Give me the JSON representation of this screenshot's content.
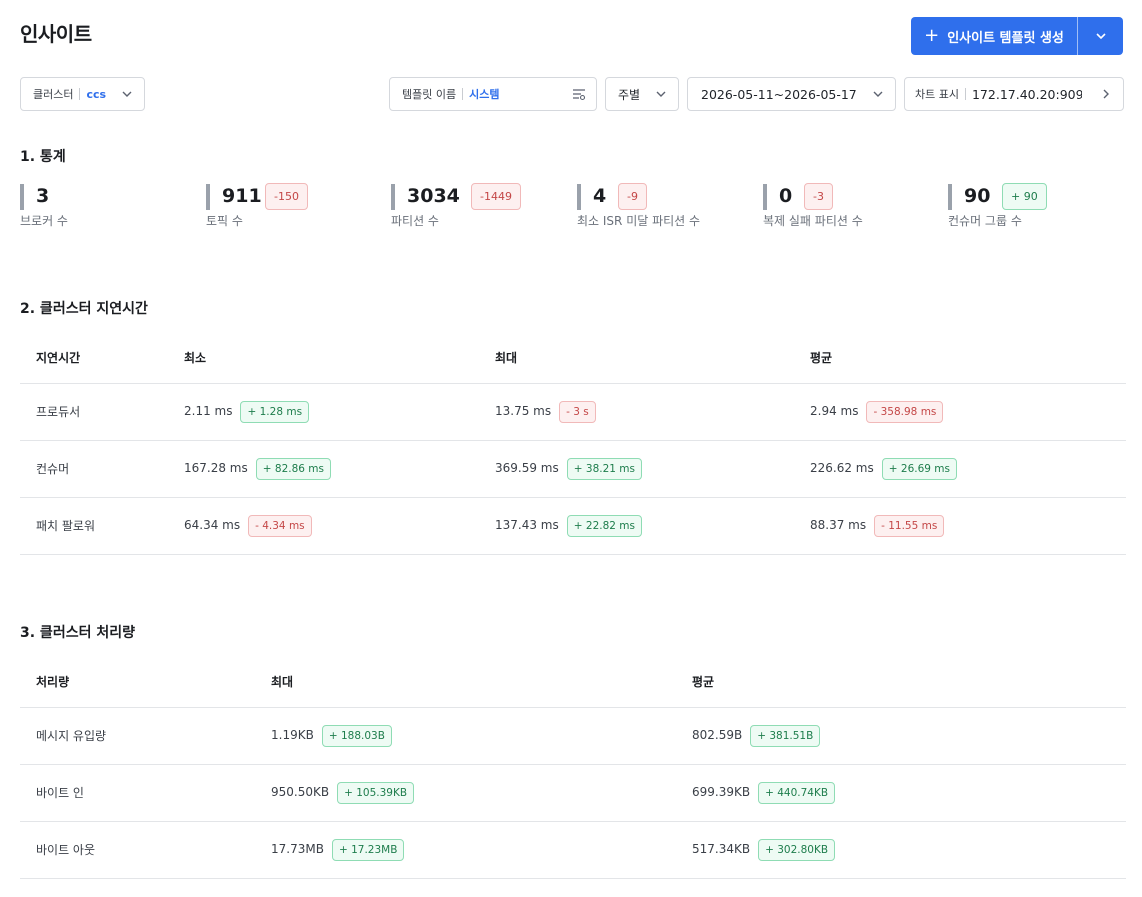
{
  "header": {
    "title": "인사이트",
    "create_button": "인사이트 템플릿 생성",
    "create_plus": "+"
  },
  "filters": {
    "cluster_label": "클러스터",
    "cluster_value": "ccs",
    "template_label": "템플릿 이름",
    "template_value": "시스템",
    "period_value": "주별",
    "date_range": "2026-05-11~2026-05-17",
    "chart_label": "차트 표시",
    "chart_value": "172.17.40.20:9092"
  },
  "stats": {
    "title": "1. 통계",
    "items": [
      {
        "value": "3",
        "caption": "브로커 수"
      },
      {
        "value": "911",
        "delta": "-150",
        "caption": "토픽 수"
      },
      {
        "value": "3034",
        "delta": "-1449",
        "caption": "파티션 수"
      },
      {
        "value": "4",
        "delta": "-9",
        "caption": "최소 ISR 미달 파티션 수"
      },
      {
        "value": "0",
        "delta": "-3",
        "caption": "복제 실패 파티션 수"
      },
      {
        "value": "90",
        "delta": "+ 90",
        "caption": "컨슈머 그룹 수"
      }
    ]
  },
  "latency": {
    "title": "2. 클러스터 지연시간",
    "columns": [
      "지연시간",
      "최소",
      "최대",
      "평균"
    ],
    "rows": [
      {
        "name": "프로듀서",
        "min": "2.11 ms",
        "min_delta": "+ 1.28 ms",
        "max": "13.75 ms",
        "max_delta": "- 3 s",
        "avg": "2.94 ms",
        "avg_delta": "- 358.98 ms"
      },
      {
        "name": "컨슈머",
        "min": "167.28 ms",
        "min_delta": "+ 82.86 ms",
        "max": "369.59 ms",
        "max_delta": "+ 38.21 ms",
        "avg": "226.62 ms",
        "avg_delta": "+ 26.69 ms"
      },
      {
        "name": "패치 팔로워",
        "min": "64.34 ms",
        "min_delta": "- 4.34 ms",
        "max": "137.43 ms",
        "max_delta": "+ 22.82 ms",
        "avg": "88.37 ms",
        "avg_delta": "- 11.55 ms"
      }
    ]
  },
  "throughput": {
    "title": "3. 클러스터 처리량",
    "columns": [
      "처리량",
      "최대",
      "평균"
    ],
    "rows": [
      {
        "name": "메시지 유입량",
        "max": "1.19KB",
        "max_delta": "+ 188.03B",
        "avg": "802.59B",
        "avg_delta": "+ 381.51B"
      },
      {
        "name": "바이트 인",
        "max": "950.50KB",
        "max_delta": "+ 105.39KB",
        "avg": "699.39KB",
        "avg_delta": "+ 440.74KB"
      },
      {
        "name": "바이트 아웃",
        "max": "17.73MB",
        "max_delta": "+ 17.23MB",
        "avg": "517.34KB",
        "avg_delta": "+ 302.80KB"
      }
    ]
  },
  "colors": {
    "primary": "#2f6fec",
    "negative": "#c44747",
    "positive": "#1e7d4c"
  }
}
